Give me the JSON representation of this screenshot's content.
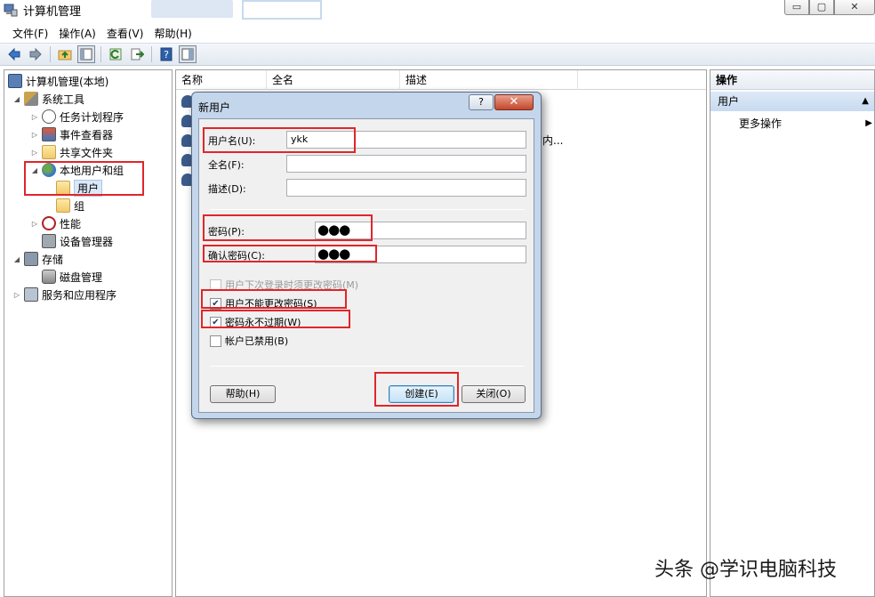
{
  "window": {
    "title": "计算机管理",
    "buttons": {
      "minimize": "▭",
      "maximize": "▢",
      "close": "✕"
    }
  },
  "menubar": [
    "文件(F)",
    "操作(A)",
    "查看(V)",
    "帮助(H)"
  ],
  "toolbar": {
    "icons": [
      "back-icon",
      "forward-icon",
      "up-folder-icon",
      "show-tree-icon",
      "refresh-icon",
      "export-icon",
      "help-icon",
      "show-action-pane-icon"
    ]
  },
  "tree": {
    "root": "计算机管理(本地)",
    "system_tools": "系统工具",
    "task_scheduler": "任务计划程序",
    "event_viewer": "事件查看器",
    "shared_folders": "共享文件夹",
    "local_users_groups": "本地用户和组",
    "users": "用户",
    "groups": "组",
    "performance": "性能",
    "device_manager": "设备管理器",
    "storage": "存储",
    "disk_management": "磁盘管理",
    "services_apps": "服务和应用程序"
  },
  "list": {
    "columns": [
      "名称",
      "全名",
      "描述"
    ],
    "partial_text": "的内..."
  },
  "actions": {
    "header": "操作",
    "section": "用户",
    "section_arrow": "▲",
    "more": "更多操作",
    "more_arrow": "▶"
  },
  "dialog": {
    "title": "新用户",
    "help_btn": "?",
    "close_btn": "✕",
    "username_label": "用户名(U):",
    "username_value": "ykk",
    "fullname_label": "全名(F):",
    "fullname_value": "",
    "description_label": "描述(D):",
    "description_value": "",
    "password_label": "密码(P):",
    "password_value": "●●●",
    "confirm_label": "确认密码(C):",
    "confirm_value": "●●●",
    "checkboxes": [
      {
        "label": "用户下次登录时须更改密码(M)",
        "checked": false,
        "disabled": true
      },
      {
        "label": "用户不能更改密码(S)",
        "checked": true,
        "disabled": false
      },
      {
        "label": "密码永不过期(W)",
        "checked": true,
        "disabled": false
      },
      {
        "label": "帐户已禁用(B)",
        "checked": false,
        "disabled": false
      }
    ],
    "help_button": "帮助(H)",
    "create_button": "创建(E)",
    "close_button": "关闭(O)"
  },
  "annotation_color": "#e0262a",
  "watermark": "头条 @学识电脑科技"
}
